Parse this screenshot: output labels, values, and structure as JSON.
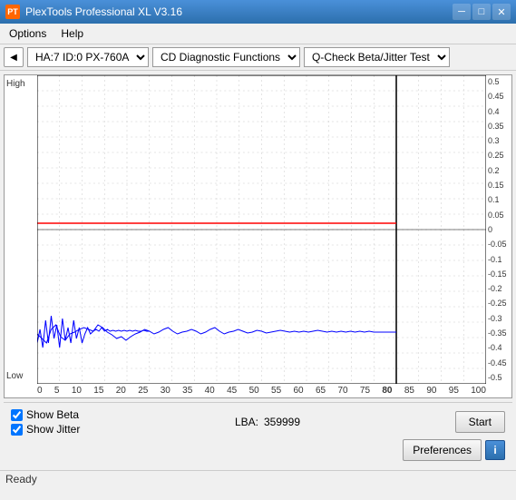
{
  "titleBar": {
    "icon": "PT",
    "title": "PlexTools Professional XL V3.16",
    "minimizeLabel": "─",
    "maximizeLabel": "□",
    "closeLabel": "✕"
  },
  "menuBar": {
    "items": [
      "Options",
      "Help"
    ]
  },
  "toolbar": {
    "driveLabel": "HA:7 ID:0  PX-760A",
    "functionLabel": "CD Diagnostic Functions",
    "testLabel": "Q-Check Beta/Jitter Test"
  },
  "chart": {
    "yLabelHigh": "High",
    "yLabelLow": "Low",
    "yTicksRight": [
      "0.5",
      "0.45",
      "0.4",
      "0.35",
      "0.3",
      "0.25",
      "0.2",
      "0.15",
      "0.1",
      "0.05",
      "0",
      "-0.05",
      "-0.1",
      "-0.15",
      "-0.2",
      "-0.25",
      "-0.3",
      "-0.35",
      "-0.4",
      "-0.45",
      "-0.5"
    ],
    "xTicks": [
      "0",
      "5",
      "10",
      "15",
      "20",
      "25",
      "30",
      "35",
      "40",
      "45",
      "50",
      "55",
      "60",
      "65",
      "70",
      "75",
      "80",
      "85",
      "90",
      "95",
      "100"
    ]
  },
  "bottomPanel": {
    "showBetaLabel": "Show Beta",
    "showJitterLabel": "Show Jitter",
    "lbaLabel": "LBA:",
    "lbaValue": "359999",
    "startLabel": "Start",
    "preferencesLabel": "Preferences",
    "infoLabel": "i"
  },
  "statusBar": {
    "text": "Ready"
  }
}
